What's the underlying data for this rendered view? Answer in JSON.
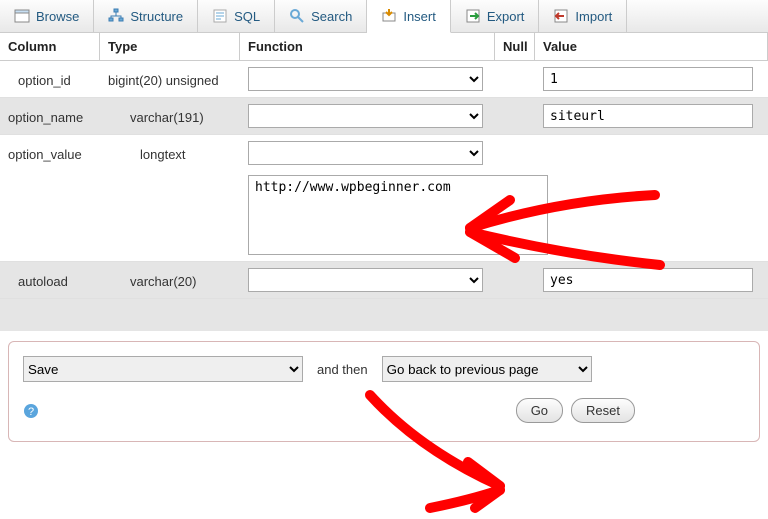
{
  "tabs": {
    "browse": {
      "label": "Browse"
    },
    "structure": {
      "label": "Structure"
    },
    "sql": {
      "label": "SQL"
    },
    "search": {
      "label": "Search"
    },
    "insert": {
      "label": "Insert"
    },
    "export": {
      "label": "Export"
    },
    "import": {
      "label": "Import"
    }
  },
  "thead": {
    "column": "Column",
    "type": "Type",
    "function": "Function",
    "null": "Null",
    "value": "Value"
  },
  "rows": {
    "option_id": {
      "name": "option_id",
      "type": "bigint(20) unsigned",
      "value": "1"
    },
    "option_name": {
      "name": "option_name",
      "type": "varchar(191)",
      "value": "siteurl"
    },
    "option_value": {
      "name": "option_value",
      "type": "longtext",
      "value": "http://www.wpbeginner.com"
    },
    "autoload": {
      "name": "autoload",
      "type": "varchar(20)",
      "value": "yes"
    }
  },
  "action": {
    "save_option": "Save",
    "and_then": "and then",
    "then_option": "Go back to previous page",
    "go": "Go",
    "reset": "Reset"
  }
}
